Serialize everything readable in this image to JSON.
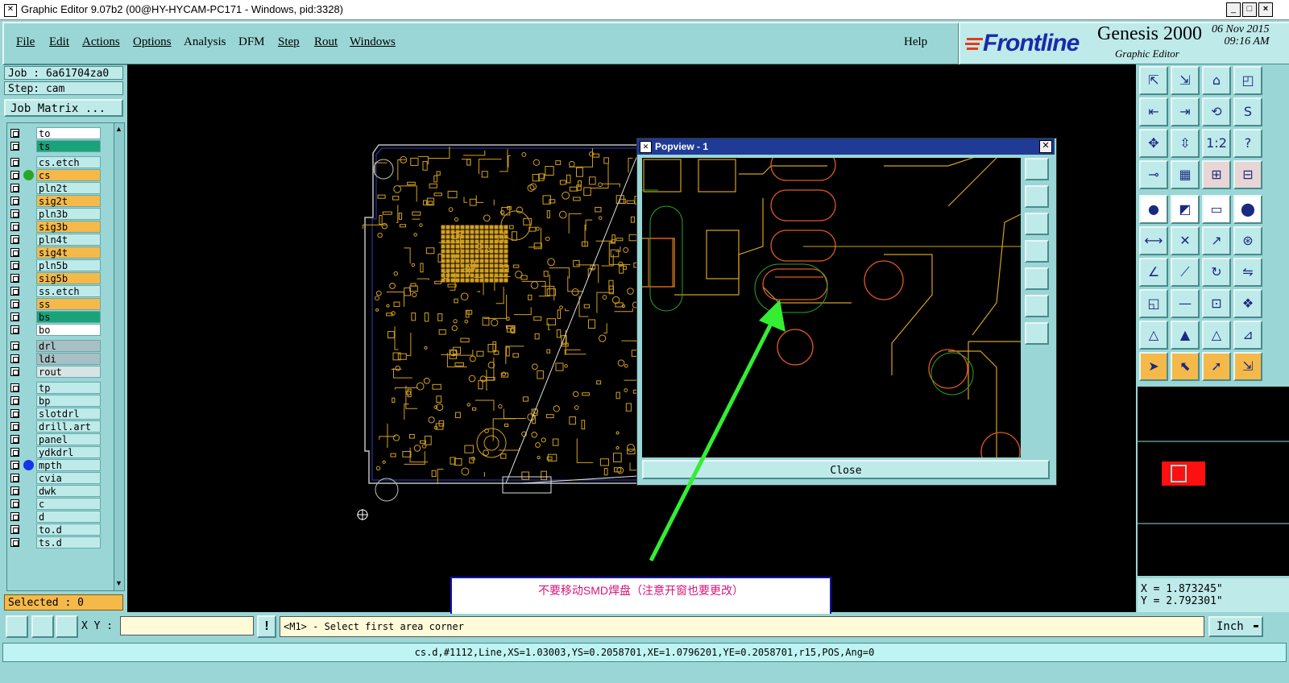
{
  "window": {
    "title": "Graphic Editor 9.07b2 (00@HY-HYCAM-PC171 - Windows, pid:3328)",
    "controls": [
      "_",
      "□",
      "×"
    ]
  },
  "menu": {
    "items": [
      "File",
      "Edit",
      "Actions",
      "Options",
      "Analysis",
      "DFM",
      "Step",
      "Rout",
      "Windows"
    ],
    "help": "Help"
  },
  "brand": {
    "logo": "Frontline",
    "product": "Genesis 2000",
    "subtitle": "Graphic Editor",
    "date": "06 Nov 2015",
    "time": "09:16 AM"
  },
  "job": {
    "job_label": "Job : 6a61704za0",
    "step_label": "Step: cam",
    "matrix_button": "Job Matrix ..."
  },
  "layers": [
    {
      "name": "to",
      "bg": "#ffffff",
      "dot": "",
      "arrow": true
    },
    {
      "name": "ts",
      "bg": "#1aa37a",
      "dot": "",
      "arrow": true
    },
    {
      "name": "cs.etch",
      "bg": "#bfeaea",
      "dot": "",
      "arrow": false
    },
    {
      "name": "cs",
      "bg": "#f5b94a",
      "dot": "#2aa52a",
      "arrow": true
    },
    {
      "name": "pln2t",
      "bg": "#bfeaea",
      "dot": "",
      "arrow": false
    },
    {
      "name": "sig2t",
      "bg": "#f5b94a",
      "dot": "",
      "arrow": true
    },
    {
      "name": "pln3b",
      "bg": "#bfeaea",
      "dot": "",
      "arrow": false
    },
    {
      "name": "sig3b",
      "bg": "#f5b94a",
      "dot": "",
      "arrow": true
    },
    {
      "name": "pln4t",
      "bg": "#bfeaea",
      "dot": "",
      "arrow": false
    },
    {
      "name": "sig4t",
      "bg": "#f5b94a",
      "dot": "",
      "arrow": true
    },
    {
      "name": "pln5b",
      "bg": "#bfeaea",
      "dot": "",
      "arrow": false
    },
    {
      "name": "sig5b",
      "bg": "#f5b94a",
      "dot": "",
      "arrow": true
    },
    {
      "name": "ss.etch",
      "bg": "#bfeaea",
      "dot": "",
      "arrow": false
    },
    {
      "name": "ss",
      "bg": "#f5b94a",
      "dot": "",
      "arrow": true
    },
    {
      "name": "bs",
      "bg": "#1aa37a",
      "dot": "",
      "arrow": true
    },
    {
      "name": "bo",
      "bg": "#ffffff",
      "dot": "",
      "arrow": true
    },
    {
      "name": "drl",
      "bg": "#a9bfc6",
      "dot": "",
      "arrow": false
    },
    {
      "name": "ldi",
      "bg": "#a9bfc6",
      "dot": "",
      "arrow": false
    },
    {
      "name": "rout",
      "bg": "#d8e4e4",
      "dot": "",
      "arrow": false
    },
    {
      "name": "tp",
      "bg": "#bfeaea",
      "dot": "",
      "arrow": true
    },
    {
      "name": "bp",
      "bg": "#bfeaea",
      "dot": "",
      "arrow": true
    },
    {
      "name": "slotdrl",
      "bg": "#bfeaea",
      "dot": "",
      "arrow": false
    },
    {
      "name": "drill.art",
      "bg": "#bfeaea",
      "dot": "",
      "arrow": true
    },
    {
      "name": "panel",
      "bg": "#bfeaea",
      "dot": "",
      "arrow": true
    },
    {
      "name": "ydkdrl",
      "bg": "#bfeaea",
      "dot": "",
      "arrow": false
    },
    {
      "name": "mpth",
      "bg": "#bfeaea",
      "dot": "#1535e8",
      "arrow": false
    },
    {
      "name": "cvia",
      "bg": "#bfeaea",
      "dot": "",
      "arrow": false
    },
    {
      "name": "dwk",
      "bg": "#bfeaea",
      "dot": "",
      "arrow": false
    },
    {
      "name": "c",
      "bg": "#bfeaea",
      "dot": "",
      "arrow": false
    },
    {
      "name": "d",
      "bg": "#bfeaea",
      "dot": "",
      "arrow": false
    },
    {
      "name": "to.d",
      "bg": "#bfeaea",
      "dot": "",
      "arrow": true
    },
    {
      "name": "ts.d",
      "bg": "#bfeaea",
      "dot": "",
      "arrow": true
    }
  ],
  "selected_label": "Selected : 0",
  "popview": {
    "title": "Popview - 1",
    "close_label": "Close"
  },
  "annotation": {
    "text": "不要移动SMD焊盘（注意开窗也要更改）"
  },
  "coords": {
    "x": "X = 1.873245\"",
    "y": "Y = 2.792301\""
  },
  "command": {
    "xy_label": "X Y :",
    "xy_value": "",
    "prompt": "<M1> - Select first area corner",
    "unit": "Inch"
  },
  "status": "cs.d,#1112,Line,XS=1.03003,YS=0.2058701,XE=1.0796201,YE=0.2058701,r15,POS,Ang=0",
  "colors": {
    "panel": "#9ad6d6",
    "canvas": "#000000",
    "copper": "#d4a020",
    "outline": "#c0c0c0",
    "arrow": "#33ee33",
    "annotation_text": "#d6157a"
  }
}
